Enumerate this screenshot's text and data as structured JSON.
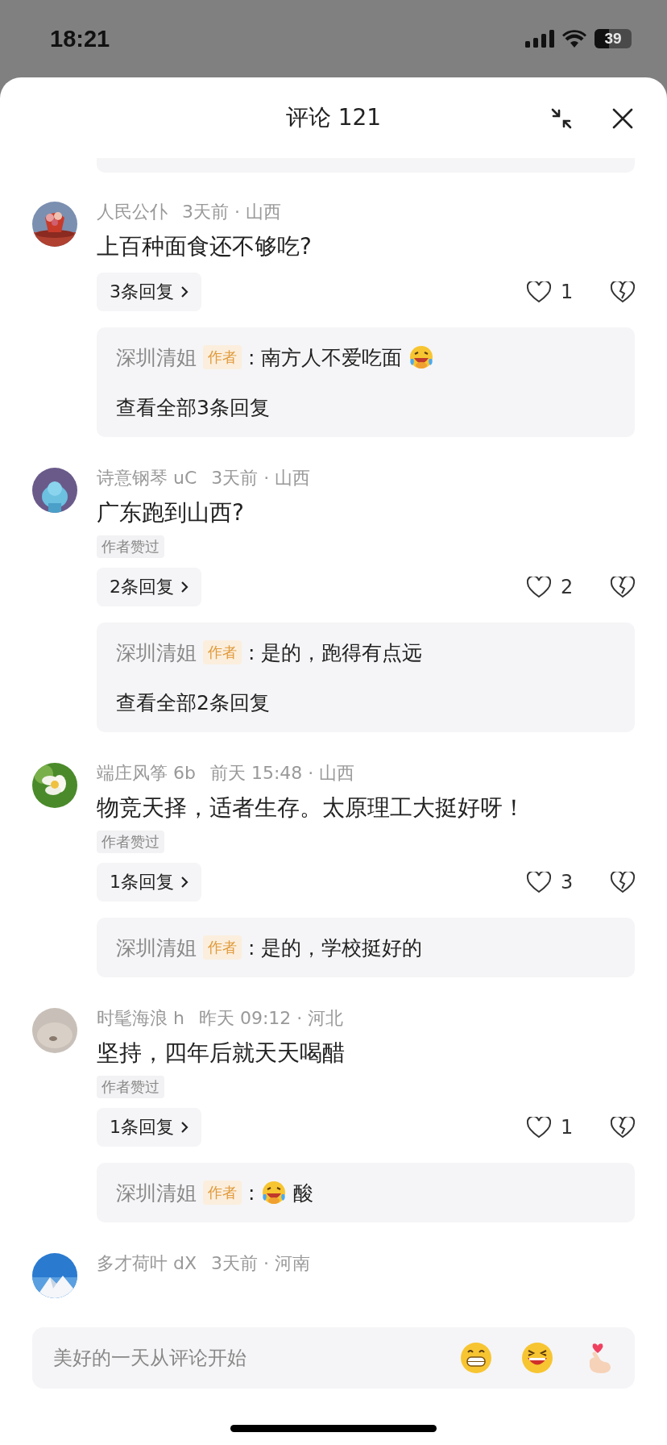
{
  "status_bar": {
    "time": "18:21",
    "battery": "39"
  },
  "header": {
    "title": "评论 121"
  },
  "comments": [
    {
      "author": "人民公仆",
      "meta": "3天前 · 山西",
      "text": "上百种面食还不够吃?",
      "replies_button": "3条回复",
      "likes": "1",
      "replies": [
        {
          "author": "深圳清姐",
          "badge": "作者",
          "separator": ":",
          "parts": [
            {
              "kind": "text",
              "text": "南方人不爱吃面"
            },
            {
              "kind": "emoji"
            }
          ]
        }
      ],
      "view_all": "查看全部3条回复"
    },
    {
      "author": "诗意钢琴 uC",
      "meta": "3天前 · 山西",
      "text": "广东跑到山西?",
      "tag": "作者赞过",
      "replies_button": "2条回复",
      "likes": "2",
      "replies": [
        {
          "author": "深圳清姐",
          "badge": "作者",
          "separator": ":",
          "parts": [
            {
              "kind": "text",
              "text": "是的，跑得有点远"
            }
          ]
        }
      ],
      "view_all": "查看全部2条回复"
    },
    {
      "author": "端庄风筝 6b",
      "meta": "前天 15:48 · 山西",
      "text": "物竞天择，适者生存。太原理工大挺好呀！",
      "tag": "作者赞过",
      "replies_button": "1条回复",
      "likes": "3",
      "replies": [
        {
          "author": "深圳清姐",
          "badge": "作者",
          "separator": ":",
          "parts": [
            {
              "kind": "text",
              "text": "是的，学校挺好的"
            }
          ]
        }
      ]
    },
    {
      "author": "时髦海浪 h",
      "meta": "昨天 09:12 · 河北",
      "text": "坚持，四年后就天天喝醋",
      "tag": "作者赞过",
      "replies_button": "1条回复",
      "likes": "1",
      "replies": [
        {
          "author": "深圳清姐",
          "badge": "作者",
          "separator": ":",
          "parts": [
            {
              "kind": "emoji"
            },
            {
              "kind": "text",
              "text": "酸"
            }
          ]
        }
      ]
    },
    {
      "author": "多才荷叶 dX",
      "meta": "3天前 · 河南"
    }
  ],
  "input": {
    "placeholder": "美好的一天从评论开始"
  }
}
